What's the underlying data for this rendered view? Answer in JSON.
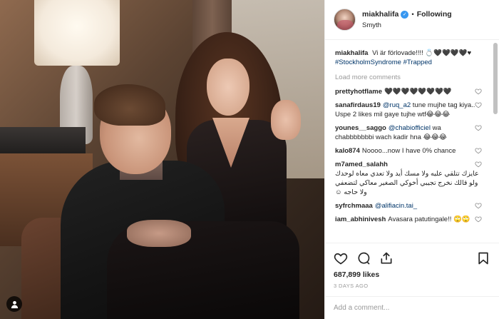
{
  "post": {
    "username": "miakhalifa",
    "verified_icon": "verified-badge-icon",
    "follow_state": "Following",
    "dot": "•",
    "location": "Smyth"
  },
  "caption": {
    "username": "miakhalifa",
    "text": "Vi är förlovade!!!! 💍🖤🖤🖤🖤♥",
    "hashtags": [
      "#StockholmSyndrome",
      "#Trapped"
    ]
  },
  "load_more": "Load more comments",
  "comments": [
    {
      "user": "prettyhotflame",
      "text": "🖤🖤🖤🖤🖤🖤🖤🖤",
      "rtl": false
    },
    {
      "user": "sanafirdaus19",
      "mention": "@ruq_a2",
      "text": " tune mujhe tag kiya.. Uspe 2 likes mil gaye tujhe wtf😂😂😂",
      "rtl": false
    },
    {
      "user": "younes__saggo",
      "mention": "@chabiofficiel",
      "text": " wa chabbbbbbbi wach kadir hna 😂😂😂",
      "rtl": false
    },
    {
      "user": "kalo874",
      "text": "Noooo...now I have 0% chance",
      "rtl": false
    },
    {
      "user": "m7amed_salahh",
      "text": "عايزك تتلقي عليه ولا مسك أيد ولا تعدي معاه لوحدك ولو قالك نخرج تجيبي أخوكي الصغير معاكي لتضعفي ولا حاجه ☺",
      "rtl": true
    },
    {
      "user": "syfrchmaaa",
      "mention": "@alifiacin.tai_",
      "text": "",
      "rtl": false
    },
    {
      "user": "iam_abhinivesh",
      "text": "Avasara patutingale!! 🙄🙄",
      "rtl": false
    }
  ],
  "likes": "687,899 likes",
  "time": "3 DAYS AGO",
  "add_comment_placeholder": "Add a comment...",
  "colors": {
    "link": "#003569",
    "verified": "#3897f0",
    "muted": "#999999",
    "border": "#efefef"
  }
}
